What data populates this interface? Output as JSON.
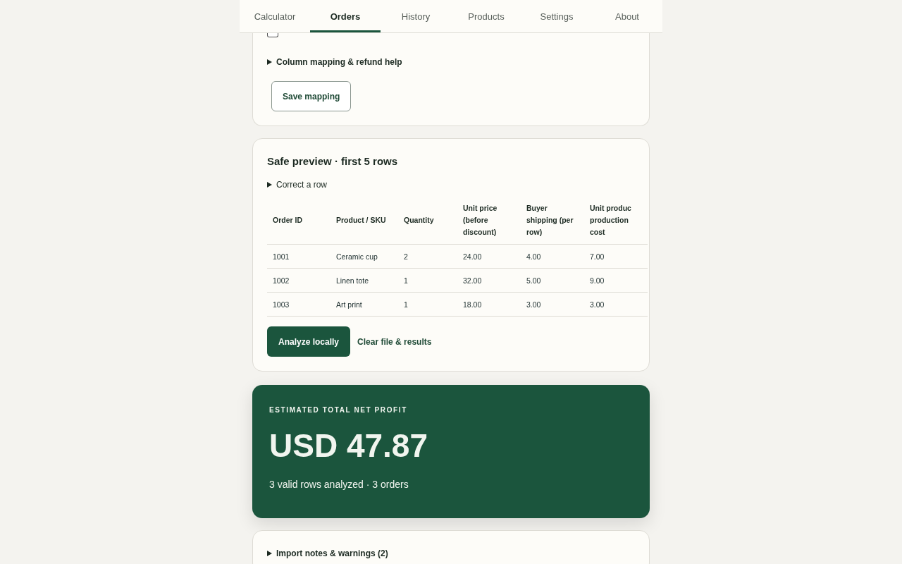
{
  "tabs": [
    {
      "label": "Calculator",
      "selected": false
    },
    {
      "label": "Orders",
      "selected": true
    },
    {
      "label": "History",
      "selected": false
    },
    {
      "label": "Products",
      "selected": false
    },
    {
      "label": "Settings",
      "selected": false
    },
    {
      "label": "About",
      "selected": false
    }
  ],
  "mapping_card": {
    "checkbox": {
      "checked": false
    },
    "help": {
      "label": "Column mapping & refund help",
      "expanded": false
    },
    "save_button": "Save mapping"
  },
  "preview_card": {
    "title": "Safe preview · first 5 rows",
    "correct_row": {
      "label": "Correct a row",
      "expanded": false
    },
    "table": {
      "columns": [
        "Order ID",
        "Product / SKU",
        "Quantity",
        "Unit price (before discount)",
        "Buyer shipping (per row)",
        "Unit produc production cost"
      ],
      "rows": [
        [
          "1001",
          "Ceramic cup",
          "2",
          "24.00",
          "4.00",
          "7.00"
        ],
        [
          "1002",
          "Linen tote",
          "1",
          "32.00",
          "5.00",
          "9.00"
        ],
        [
          "1003",
          "Art print",
          "1",
          "18.00",
          "3.00",
          "3.00"
        ]
      ]
    },
    "analyze_button": "Analyze locally",
    "clear_link": "Clear file & results"
  },
  "profit_card": {
    "label": "ESTIMATED TOTAL NET PROFIT",
    "value": "USD 47.87",
    "summary": "3 valid rows analyzed · 3 orders"
  },
  "notes": {
    "label": "Import notes & warnings (2)",
    "expanded": false
  }
}
